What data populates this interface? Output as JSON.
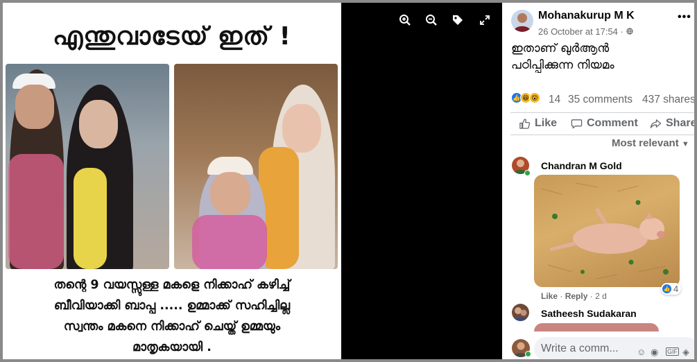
{
  "image": {
    "headline": "എന്തുവാടേയ് ഇത് !",
    "caption_lines": [
      "തന്റെ 9 വയസ്സുള്ള മകളെ നിക്കാഹ്  കഴിച്ച്",
      "ബീവിയാക്കി ബാപ്പ ..... ഉമ്മാക്ക് സഹിച്ചില്ല",
      "സ്വന്തം മകനെ നിക്കാഹ് ചെയ്ത് ഉമ്മയും",
      "മാതൃകയായി ."
    ]
  },
  "viewer_tools": [
    "zoom-in-icon",
    "zoom-out-icon",
    "tag-icon",
    "fullscreen-icon"
  ],
  "post": {
    "author": "Mohanakurup M K",
    "date": "26 October at 17:54",
    "separator": "·",
    "text_lines": [
      "ഇതാണ് ഖുർആൻ",
      "പഠിപ്പിക്കുന്ന നിയമം"
    ],
    "reaction_count": "14",
    "comments": "35 comments",
    "shares": "437 shares"
  },
  "actions": {
    "like": "Like",
    "comment": "Comment",
    "share": "Share"
  },
  "sort_label": "Most relevant",
  "comments": [
    {
      "author": "Chandran M Gold",
      "like": "Like",
      "reply": "Reply",
      "dot": "·",
      "time": "2 d",
      "reactions": "4"
    },
    {
      "author": "Satheesh Sudakaran"
    }
  ],
  "composer": {
    "placeholder": "Write a comm..."
  },
  "colors": {
    "accent": "#1877f2",
    "text": "#050505",
    "secondary": "#65676b",
    "divider": "#ced0d4"
  }
}
